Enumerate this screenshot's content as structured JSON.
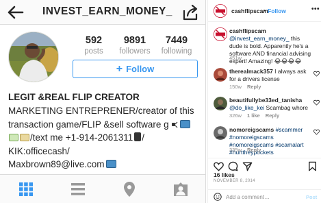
{
  "profile": {
    "username": "INVEST_EARN_MONEY_",
    "stats": [
      {
        "value": "592",
        "label": "posts"
      },
      {
        "value": "9891",
        "label": "followers"
      },
      {
        "value": "7449",
        "label": "following"
      }
    ],
    "follow_label": "Follow",
    "bio_name": "LEGIT &REAL FLIP CREATOR",
    "bio_lines": {
      "line1": "MARKETING ENTREPRENER/creator of this",
      "line2": "transaction game/FLIP &sell software g",
      "line3": "/text me +1-914-2061311",
      "line4": "KIK:officecash/",
      "line5": "Maxbrown89@live.com"
    },
    "tabs": [
      "grid",
      "list",
      "location",
      "tagged"
    ]
  },
  "post": {
    "header": {
      "username": "cashflipscam",
      "separator": "•",
      "follow_label": "Follow",
      "more": "•••"
    },
    "comments": [
      {
        "username": "cashflipscam",
        "text_pre": "",
        "mention": "@invest_earn_money_",
        "text_post": " this dude is bold. Apparently he's a software AND financial advising expert! Amazing! 😂😂😂😂",
        "time": "451w",
        "likes": "",
        "reply": ""
      },
      {
        "username": "therealmack357",
        "text_pre": " I always ask for a drivers license",
        "mention": "",
        "text_post": "",
        "time": "150w",
        "likes": "",
        "reply": "Reply"
      },
      {
        "username": "beautifullybe33ed_tanisha",
        "text_pre": "",
        "mention": "@do_like_kei",
        "text_post": " Scambag whore",
        "time": "326w",
        "likes": "1 like",
        "reply": "Reply"
      },
      {
        "username": "nomoreigscams",
        "text_pre": "",
        "mention": "#scammer #nomoreigscams #nomoreigscams #scamalart #hurttheypockets",
        "text_post": "",
        "time": "335w",
        "likes": "",
        "reply": "Reply"
      }
    ],
    "likes": "16 likes",
    "date": "NOVEMBER 8, 2014",
    "comment_placeholder": "Add a comment…",
    "post_label": "Post"
  },
  "colors": {
    "accent": "#3897f0",
    "text": "#262626",
    "muted": "#8e8e8e",
    "border": "#dbdbdb",
    "scam_red": "#c8102e"
  }
}
